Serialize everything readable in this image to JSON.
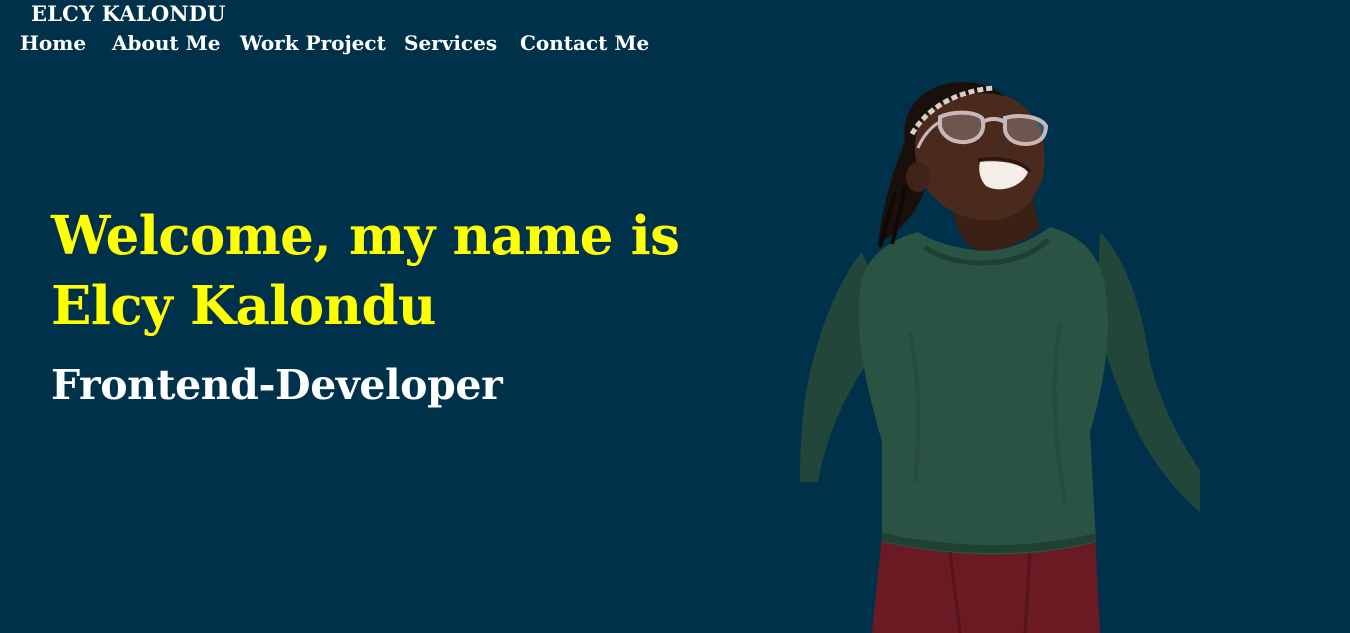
{
  "header": {
    "brand": "ELCY KALONDU"
  },
  "nav": {
    "items": [
      {
        "label": "Home"
      },
      {
        "label": "About Me"
      },
      {
        "label": "Work Project"
      },
      {
        "label": "Services"
      },
      {
        "label": "Contact Me"
      }
    ]
  },
  "hero": {
    "title_line1": "Welcome, my name is",
    "title_line2": "Elcy Kalondu",
    "subtitle": "Frontend-Developer"
  },
  "colors": {
    "background": "#00314a",
    "accent": "#ffff00",
    "text": "#ffffff"
  }
}
